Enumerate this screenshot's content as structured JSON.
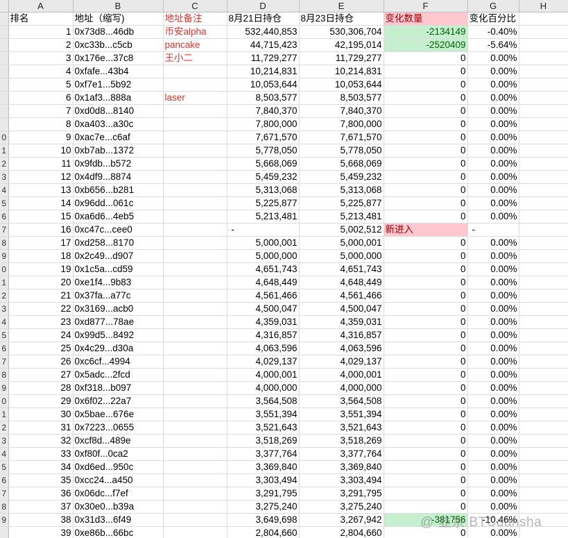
{
  "columns": [
    "",
    "A",
    "B",
    "C",
    "D",
    "E",
    "F",
    "G",
    "H"
  ],
  "headers": {
    "rank": "排名",
    "address": "地址（缩写)",
    "note": "地址备注",
    "aug21": "8月21日持仓",
    "aug23": "8月23日持仓",
    "change": "变化数量",
    "pct": "变化百分比"
  },
  "rows": [
    {
      "row": "",
      "rank": "1",
      "address": "0x73d8...46db",
      "note": "币安alpha",
      "aug21": "532,440,853",
      "aug23": "530,306,704",
      "change": "-2134149",
      "pct": "-0.40%",
      "status": "neg"
    },
    {
      "row": "",
      "rank": "2",
      "address": "0xc33b...c5cb",
      "note": "pancake",
      "aug21": "44,715,423",
      "aug23": "42,195,014",
      "change": "-2520409",
      "pct": "-5.64%",
      "status": "neg"
    },
    {
      "row": "",
      "rank": "3",
      "address": "0x176e...37c8",
      "note": "王小二",
      "aug21": "11,729,277",
      "aug23": "11,729,277",
      "change": "0",
      "pct": "0.00%",
      "status": ""
    },
    {
      "row": "",
      "rank": "4",
      "address": "0xfafe...43b4",
      "note": "",
      "aug21": "10,214,831",
      "aug23": "10,214,831",
      "change": "0",
      "pct": "0.00%",
      "status": ""
    },
    {
      "row": "",
      "rank": "5",
      "address": "0xf7e1...5b92",
      "note": "",
      "aug21": "10,053,644",
      "aug23": "10,053,644",
      "change": "0",
      "pct": "0.00%",
      "status": ""
    },
    {
      "row": "",
      "rank": "6",
      "address": "0x1af3...888a",
      "note": "laser",
      "aug21": "8,503,577",
      "aug23": "8,503,577",
      "change": "0",
      "pct": "0.00%",
      "status": ""
    },
    {
      "row": "",
      "rank": "7",
      "address": "0xd0d8...8140",
      "note": "",
      "aug21": "7,840,370",
      "aug23": "7,840,370",
      "change": "0",
      "pct": "0.00%",
      "status": ""
    },
    {
      "row": "",
      "rank": "8",
      "address": "0xa403...a30c",
      "note": "",
      "aug21": "7,800,000",
      "aug23": "7,800,000",
      "change": "0",
      "pct": "0.00%",
      "status": ""
    },
    {
      "row": "0",
      "rank": "9",
      "address": "0xac7e...c6af",
      "note": "",
      "aug21": "7,671,570",
      "aug23": "7,671,570",
      "change": "0",
      "pct": "0.00%",
      "status": ""
    },
    {
      "row": "1",
      "rank": "10",
      "address": "0xb7ab...1372",
      "note": "",
      "aug21": "5,778,050",
      "aug23": "5,778,050",
      "change": "0",
      "pct": "0.00%",
      "status": ""
    },
    {
      "row": "2",
      "rank": "11",
      "address": "0x9fdb...b572",
      "note": "",
      "aug21": "5,668,069",
      "aug23": "5,668,069",
      "change": "0",
      "pct": "0.00%",
      "status": ""
    },
    {
      "row": "3",
      "rank": "12",
      "address": "0x4df9...8874",
      "note": "",
      "aug21": "5,459,232",
      "aug23": "5,459,232",
      "change": "0",
      "pct": "0.00%",
      "status": ""
    },
    {
      "row": "4",
      "rank": "13",
      "address": "0xb656...b281",
      "note": "",
      "aug21": "5,313,068",
      "aug23": "5,313,068",
      "change": "0",
      "pct": "0.00%",
      "status": ""
    },
    {
      "row": "5",
      "rank": "14",
      "address": "0x96dd...061c",
      "note": "",
      "aug21": "5,225,877",
      "aug23": "5,225,877",
      "change": "0",
      "pct": "0.00%",
      "status": ""
    },
    {
      "row": "6",
      "rank": "15",
      "address": "0xa6d6...4eb5",
      "note": "",
      "aug21": "5,213,481",
      "aug23": "5,213,481",
      "change": "0",
      "pct": "0.00%",
      "status": ""
    },
    {
      "row": "7",
      "rank": "16",
      "address": "0xc47c...cee0",
      "note": "",
      "aug21": "-",
      "aug23": "5,002,512",
      "change": "新进入",
      "pct": "-",
      "status": "new"
    },
    {
      "row": "8",
      "rank": "17",
      "address": "0xd258...8170",
      "note": "",
      "aug21": "5,000,001",
      "aug23": "5,000,001",
      "change": "0",
      "pct": "0.00%",
      "status": ""
    },
    {
      "row": "9",
      "rank": "18",
      "address": "0x2c49...d907",
      "note": "",
      "aug21": "5,000,000",
      "aug23": "5,000,000",
      "change": "0",
      "pct": "0.00%",
      "status": ""
    },
    {
      "row": "0",
      "rank": "19",
      "address": "0x1c5a...cd59",
      "note": "",
      "aug21": "4,651,743",
      "aug23": "4,651,743",
      "change": "0",
      "pct": "0.00%",
      "status": ""
    },
    {
      "row": "1",
      "rank": "20",
      "address": "0xe1f4...9b83",
      "note": "",
      "aug21": "4,648,449",
      "aug23": "4,648,449",
      "change": "0",
      "pct": "0.00%",
      "status": ""
    },
    {
      "row": "2",
      "rank": "21",
      "address": "0x37fa...a77c",
      "note": "",
      "aug21": "4,561,466",
      "aug23": "4,561,466",
      "change": "0",
      "pct": "0.00%",
      "status": ""
    },
    {
      "row": "3",
      "rank": "22",
      "address": "0x3169...acb0",
      "note": "",
      "aug21": "4,500,047",
      "aug23": "4,500,047",
      "change": "0",
      "pct": "0.00%",
      "status": ""
    },
    {
      "row": "4",
      "rank": "23",
      "address": "0xd877...78ae",
      "note": "",
      "aug21": "4,359,031",
      "aug23": "4,359,031",
      "change": "0",
      "pct": "0.00%",
      "status": ""
    },
    {
      "row": "5",
      "rank": "24",
      "address": "0x99d5...8492",
      "note": "",
      "aug21": "4,316,857",
      "aug23": "4,316,857",
      "change": "0",
      "pct": "0.00%",
      "status": ""
    },
    {
      "row": "6",
      "rank": "25",
      "address": "0x4c29...d30a",
      "note": "",
      "aug21": "4,063,596",
      "aug23": "4,063,596",
      "change": "0",
      "pct": "0.00%",
      "status": ""
    },
    {
      "row": "7",
      "rank": "26",
      "address": "0xc6cf...4994",
      "note": "",
      "aug21": "4,029,137",
      "aug23": "4,029,137",
      "change": "0",
      "pct": "0.00%",
      "status": ""
    },
    {
      "row": "8",
      "rank": "27",
      "address": "0x5adc...2fcd",
      "note": "",
      "aug21": "4,000,001",
      "aug23": "4,000,001",
      "change": "0",
      "pct": "0.00%",
      "status": ""
    },
    {
      "row": "9",
      "rank": "28",
      "address": "0xf318...b097",
      "note": "",
      "aug21": "4,000,000",
      "aug23": "4,000,000",
      "change": "0",
      "pct": "0.00%",
      "status": ""
    },
    {
      "row": "0",
      "rank": "29",
      "address": "0x6f02...22a7",
      "note": "",
      "aug21": "3,564,508",
      "aug23": "3,564,508",
      "change": "0",
      "pct": "0.00%",
      "status": ""
    },
    {
      "row": "1",
      "rank": "30",
      "address": "0x5bae...676e",
      "note": "",
      "aug21": "3,551,394",
      "aug23": "3,551,394",
      "change": "0",
      "pct": "0.00%",
      "status": ""
    },
    {
      "row": "2",
      "rank": "31",
      "address": "0x7223...0655",
      "note": "",
      "aug21": "3,521,643",
      "aug23": "3,521,643",
      "change": "0",
      "pct": "0.00%",
      "status": ""
    },
    {
      "row": "3",
      "rank": "32",
      "address": "0xcf8d...489e",
      "note": "",
      "aug21": "3,518,269",
      "aug23": "3,518,269",
      "change": "0",
      "pct": "0.00%",
      "status": ""
    },
    {
      "row": "4",
      "rank": "33",
      "address": "0xf80f...0ca2",
      "note": "",
      "aug21": "3,377,764",
      "aug23": "3,377,764",
      "change": "0",
      "pct": "0.00%",
      "status": ""
    },
    {
      "row": "5",
      "rank": "34",
      "address": "0xd6ed...950c",
      "note": "",
      "aug21": "3,369,840",
      "aug23": "3,369,840",
      "change": "0",
      "pct": "0.00%",
      "status": ""
    },
    {
      "row": "6",
      "rank": "35",
      "address": "0xcc24...a450",
      "note": "",
      "aug21": "3,303,494",
      "aug23": "3,303,494",
      "change": "0",
      "pct": "0.00%",
      "status": ""
    },
    {
      "row": "7",
      "rank": "36",
      "address": "0x06dc...f7ef",
      "note": "",
      "aug21": "3,291,795",
      "aug23": "3,291,795",
      "change": "0",
      "pct": "0.00%",
      "status": ""
    },
    {
      "row": "8",
      "rank": "37",
      "address": "0x30e0...b39a",
      "note": "",
      "aug21": "3,275,240",
      "aug23": "3,275,240",
      "change": "0",
      "pct": "0.00%",
      "status": ""
    },
    {
      "row": "9",
      "rank": "38",
      "address": "0x31d3...6f49",
      "note": "",
      "aug21": "3,649,698",
      "aug23": "3,267,942",
      "change": "-381756",
      "pct": "-10.46%",
      "status": "neg"
    },
    {
      "row": "",
      "rank": "39",
      "address": "0xe86b...66bc",
      "note": "",
      "aug21": "2,804,660",
      "aug23": "2,804,660",
      "change": "0",
      "pct": "0.00%",
      "status": ""
    }
  ],
  "watermark": "@ 韭余 BTCdansha",
  "colors": {
    "negative_fill": "#c6efcf",
    "new_fill": "#ffc7ce",
    "note_text": "#e8312b",
    "header_fill": "#e9e9e9"
  }
}
